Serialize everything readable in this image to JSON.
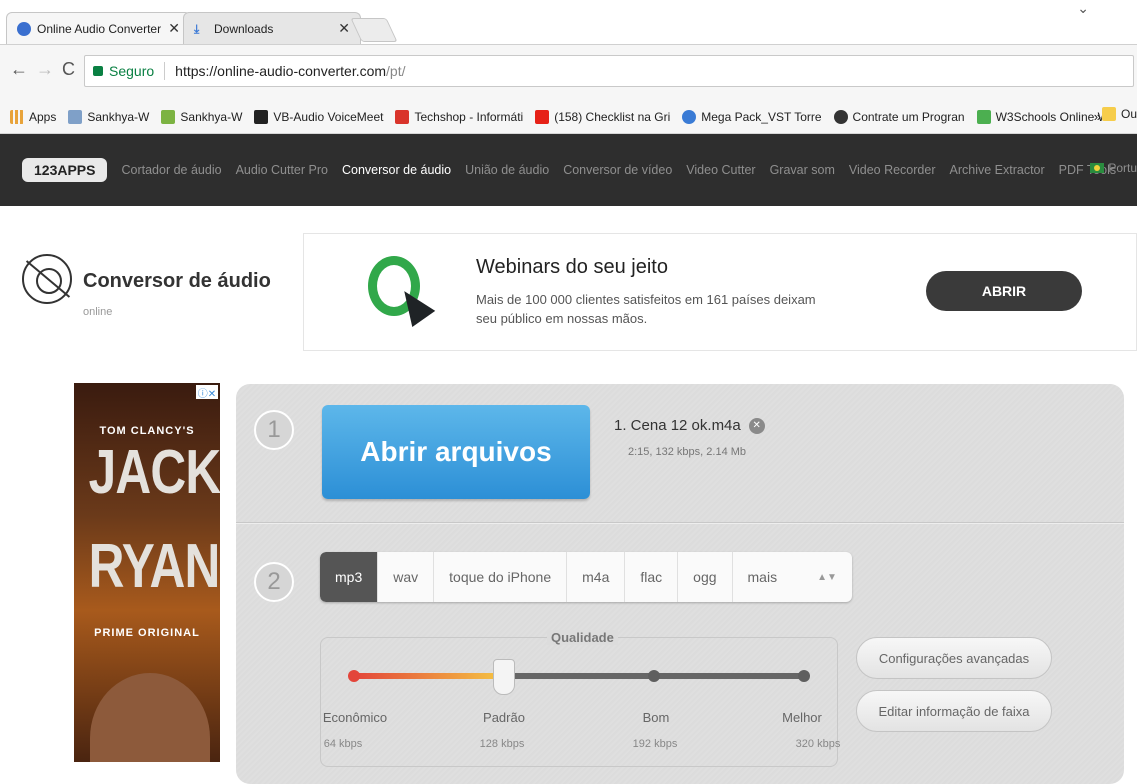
{
  "browser": {
    "tabs": [
      {
        "title": "Online Audio Converter - ",
        "favicon_color": "#3a6fcf"
      },
      {
        "title": "Downloads",
        "favicon_color": "#3b79d6"
      }
    ],
    "nav": {
      "back": "←",
      "forward": "→",
      "reload": "C"
    },
    "secure_label": "Seguro",
    "url_host": "https://online-audio-converter.com",
    "url_path": "/pt/",
    "bookmarks": [
      {
        "label": "Apps",
        "icon_color": "#e8a33a"
      },
      {
        "label": "Sankhya-W",
        "icon_color": "#7fa0c8"
      },
      {
        "label": "Sankhya-W",
        "icon_color": "#7cb342"
      },
      {
        "label": "VB-Audio VoiceMeet",
        "icon_color": "#222222"
      },
      {
        "label": "Techshop - Informáti",
        "icon_color": "#d9342b"
      },
      {
        "label": "(158) Checklist na Gri",
        "icon_color": "#e62117"
      },
      {
        "label": "Mega Pack_VST Torre",
        "icon_color": "#3a7bd5"
      },
      {
        "label": "Contrate um Progran",
        "icon_color": "#333333"
      },
      {
        "label": "W3Schools Online W",
        "icon_color": "#4caf50"
      }
    ],
    "bookmarks_more": "»",
    "bookmark_folder": "Ou"
  },
  "site_nav": {
    "logo": "123APPS",
    "links": [
      {
        "label": "Cortador de áudio",
        "active": false
      },
      {
        "label": "Audio Cutter Pro",
        "active": false
      },
      {
        "label": "Conversor de áudio",
        "active": true
      },
      {
        "label": "União de áudio",
        "active": false
      },
      {
        "label": "Conversor de vídeo",
        "active": false
      },
      {
        "label": "Video Cutter",
        "active": false
      },
      {
        "label": "Gravar som",
        "active": false
      },
      {
        "label": "Video Recorder",
        "active": false
      },
      {
        "label": "Archive Extractor",
        "active": false
      },
      {
        "label": "PDF Tools",
        "active": false
      }
    ],
    "language": "Portu"
  },
  "header": {
    "title": "Conversor de áudio",
    "subtitle": "online"
  },
  "ad_banner": {
    "title": "Webinars do seu jeito",
    "description": "Mais de 100 000 clientes satisfeitos em 161 países deixam seu público em nossas mãos.",
    "button": "ABRIR"
  },
  "side_ad": {
    "top_line": "TOM CLANCY'S",
    "line1": "JACK",
    "line2": "RYAN",
    "bottom_line": "PRIME ORIGINAL",
    "close": "ⓘ✕"
  },
  "converter": {
    "step1": "1",
    "step2": "2",
    "open_button": "Abrir arquivos",
    "file": {
      "name": "1. Cena 12 ok.m4a",
      "meta": "2:15, 132 kbps, 2.14 Mb",
      "remove_icon": "✕"
    },
    "formats": [
      "mp3",
      "wav",
      "toque do iPhone",
      "m4a",
      "flac",
      "ogg",
      "mais"
    ],
    "selected_format": "mp3",
    "more_arrows": "▲▼",
    "quality": {
      "title": "Qualidade",
      "selected_index": 1,
      "levels": [
        {
          "label": "Econômico",
          "kbps": "64 kbps"
        },
        {
          "label": "Padrão",
          "kbps": "128 kbps"
        },
        {
          "label": "Bom",
          "kbps": "192 kbps"
        },
        {
          "label": "Melhor",
          "kbps": "320 kbps"
        }
      ]
    },
    "advanced_button": "Configurações avançadas",
    "track_info_button": "Editar informação de faixa"
  }
}
